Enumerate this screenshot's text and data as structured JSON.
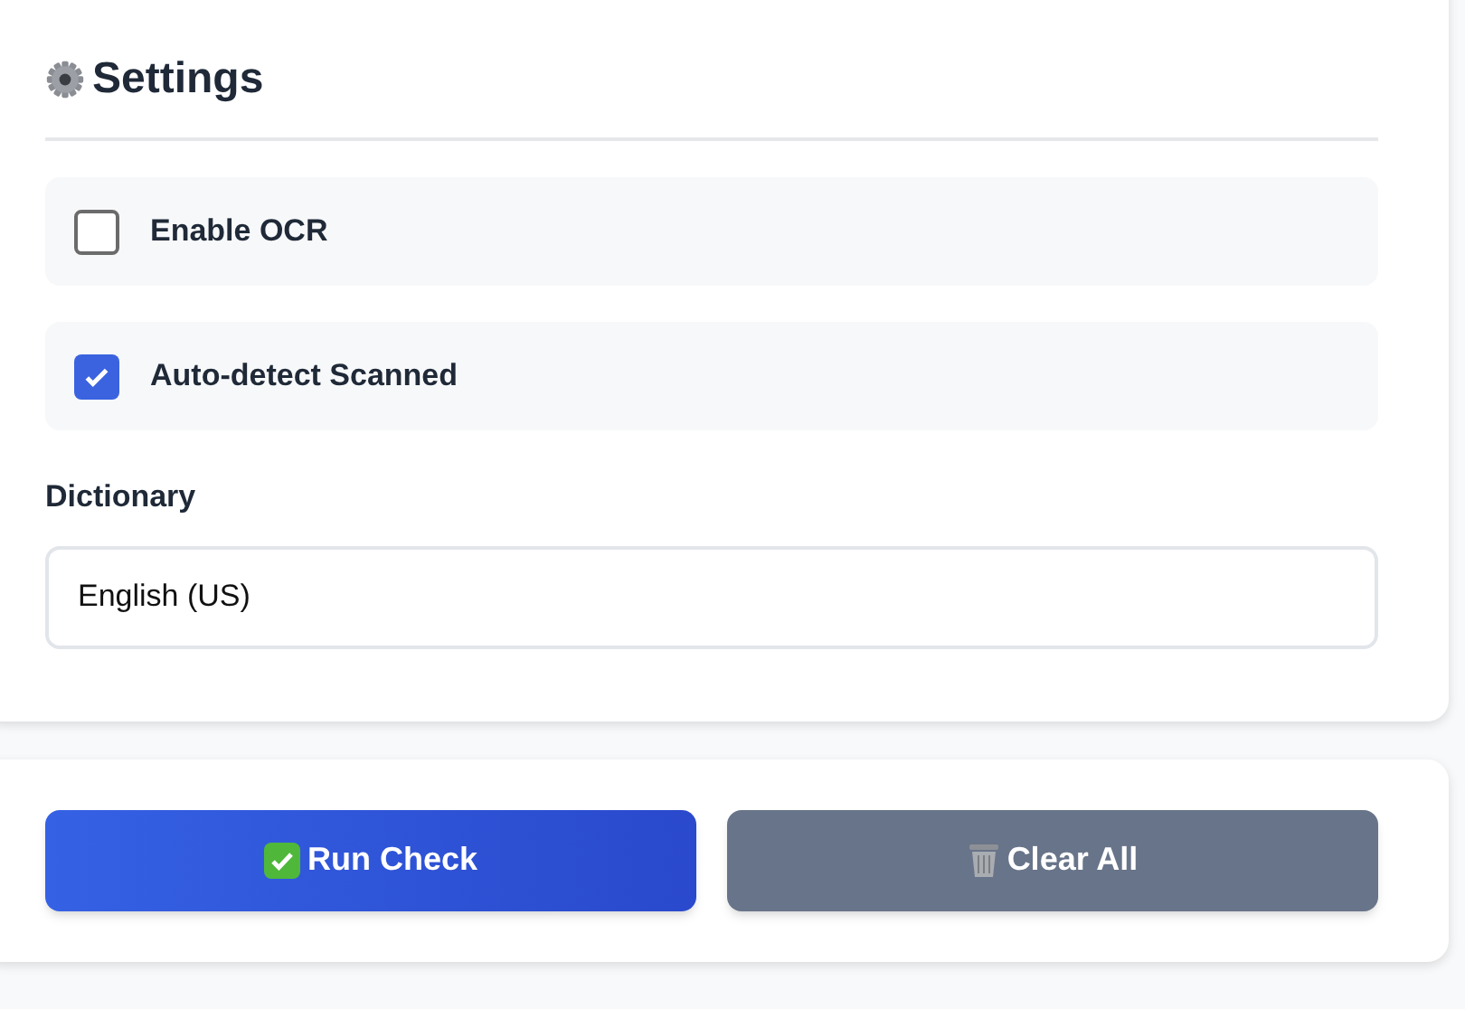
{
  "settings": {
    "title": "Settings",
    "options": [
      {
        "label": "Enable OCR",
        "checked": false
      },
      {
        "label": "Auto-detect Scanned",
        "checked": true
      }
    ],
    "dictionary": {
      "label": "Dictionary",
      "value": "English (US)"
    }
  },
  "actions": [
    {
      "kind": "primary",
      "label": "Run Check"
    },
    {
      "kind": "secondary",
      "label": "Clear All"
    }
  ]
}
